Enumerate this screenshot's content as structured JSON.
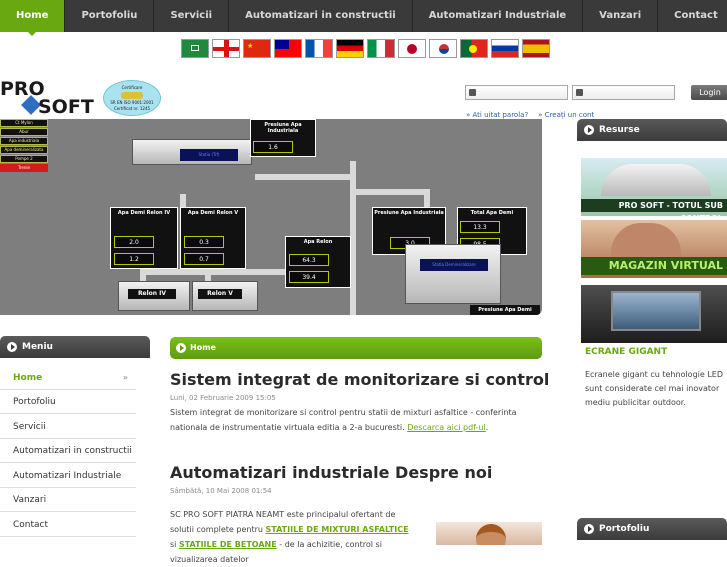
{
  "nav": {
    "items": [
      "Home",
      "Portofoliu",
      "Servicii",
      "Automatizari in constructii",
      "Automatizari Industriale",
      "Vanzari",
      "Contact"
    ],
    "active": "Home"
  },
  "flags": [
    "saudi-arabia",
    "england",
    "china",
    "taiwan",
    "france",
    "germany",
    "italy",
    "japan",
    "south-korea",
    "portugal",
    "russia",
    "spain"
  ],
  "logo": {
    "pro": "PRO",
    "soft": "SOFT",
    "cert_line1": "Certificare",
    "cert_line2": "SR EN ISO 9001:2001",
    "cert_line3": "Certificat nr. 1245"
  },
  "login": {
    "button": "Login",
    "forgot": "» Ati uitat parola?",
    "create": "» Creați un cont"
  },
  "hero": {
    "side_list": [
      "Ct Mylon",
      "Abur",
      "Apa industriala",
      "Apa demineralizata",
      "Pompe 2",
      "Trenie"
    ],
    "panels": {
      "presiune_top": {
        "title": "Presiune Apa Industriala",
        "value": "1.6",
        "unit": "bar"
      },
      "demi_relon_iv": {
        "title": "Apa Demi Relon IV",
        "v1": "2.0",
        "v2": "1.2",
        "unit": "m³/h"
      },
      "demi_relon_v": {
        "title": "Apa Demi Relon V",
        "v1": "0.3",
        "v2": "0.7",
        "unit": "m³/h"
      },
      "apa_relon": {
        "title": "Apa Relon",
        "v1": "64.3",
        "v2": "39.4",
        "unit": "m³/h"
      },
      "presiune_demi": {
        "title": "Presiune Apa Industriala",
        "value": "3.0",
        "unit": "bar"
      },
      "total_demi": {
        "title": "Total Apa Demi",
        "v1": "13.3",
        "v2": "98.5",
        "unit": "m³/h"
      }
    },
    "tags": [
      "Relon IV",
      "Relon V"
    ],
    "screen_top": "Statia (Trf)",
    "screen_right": "Statia Demineralizare",
    "bottom_right": "Presiune Apa Demi"
  },
  "right": {
    "resurse": "Resurse",
    "banner1": "PRO SOFT - TOTUL SUB CONTROL",
    "banner2": "MAGAZIN VIRTUAL",
    "ecrane_title": "ECRANE GIGANT",
    "ecrane_text": "Ecranele gigant cu tehnologie LED sunt considerate cel mai inovator mediu publicitar outdoor.",
    "portofoliu": "Portofoliu"
  },
  "menu": {
    "title": "Meniu",
    "items": [
      "Home",
      "Portofoliu",
      "Servicii",
      "Automatizari in constructii",
      "Automatizari Industriale",
      "Vanzari",
      "Contact"
    ],
    "active_arrows": "»"
  },
  "content": {
    "breadcrumb": "Home",
    "article1": {
      "title": "Sistem integrat de monitorizare si control",
      "date": "Luni, 02 Februarie 2009 15:05",
      "body": "Sistem integrat de monitorizare si control pentru statii de mixturi asfaltice - conferinta nationala de instrumentatie virtuala editia a 2-a bucuresti. ",
      "link": "Descarca aici pdf-ul",
      "after_link": "."
    },
    "article2": {
      "title": "Automatizari industriale Despre noi",
      "date": "Sâmbătă, 10 Mai 2008 01:54",
      "body1": "SC PRO SOFT PIATRA NEAMT este principalul ofertant de",
      "body2": "solutii complete pentru ",
      "highlight1": "STATIILE DE MIXTURI ASFALTICE",
      "body3": "si ",
      "highlight2": "STATIILE DE BETOANE",
      "body4": " - de la achizitie, control si vizualizarea datelor"
    }
  },
  "colors": {
    "accent": "#6aa812",
    "nav_bg": "#3a3a3a",
    "hero_bg": "#7e7e7e"
  }
}
